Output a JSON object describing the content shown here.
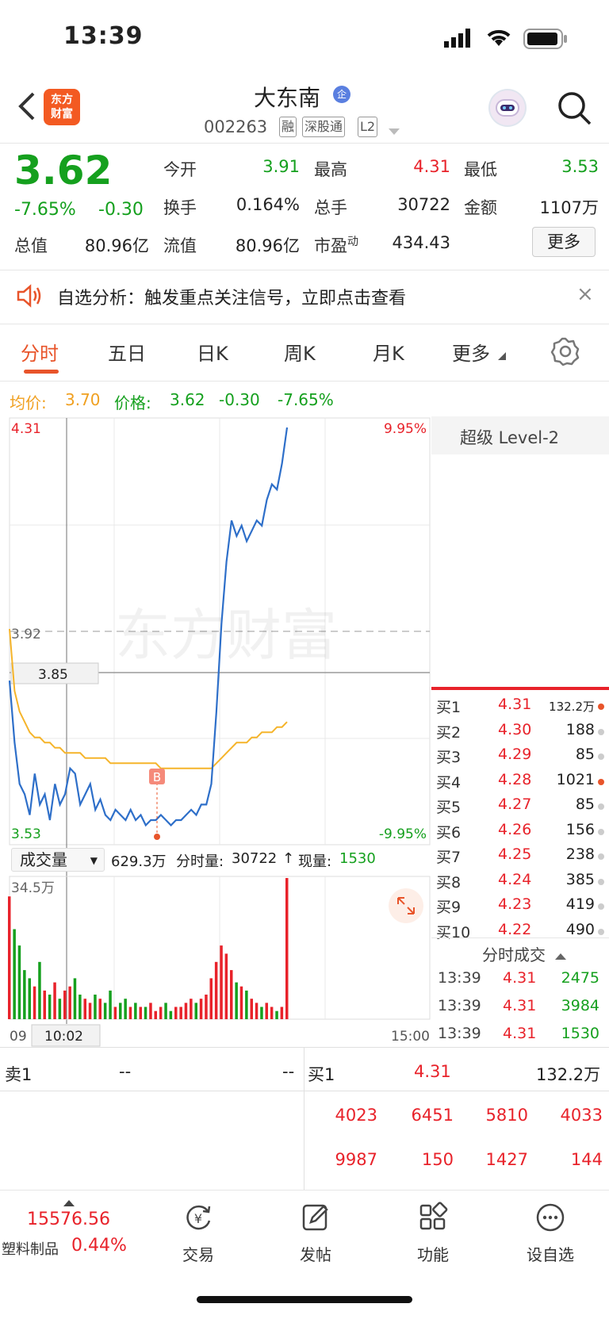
{
  "status_bar": {
    "time": "13:39"
  },
  "header": {
    "logo_text_1": "东方",
    "logo_text_2": "财富",
    "stock_name": "大东南",
    "stock_badge": "企",
    "stock_code": "002263",
    "tags": [
      "融",
      "深股通",
      "L2"
    ]
  },
  "quote": {
    "price": "3.62",
    "change_pct": "-7.65%",
    "change_amt": "-0.30",
    "fields": [
      {
        "label": "今开",
        "value": "3.91",
        "color": "green"
      },
      {
        "label": "最高",
        "value": "4.31",
        "color": "red"
      },
      {
        "label": "最低",
        "value": "3.53",
        "color": "green"
      },
      {
        "label": "换手",
        "value": "0.164%",
        "color": "black"
      },
      {
        "label": "总手",
        "value": "30722",
        "color": "black"
      },
      {
        "label": "金额",
        "value": "1107万",
        "color": "black"
      },
      {
        "label": "总值",
        "value": "80.96亿",
        "color": "black"
      },
      {
        "label": "流值",
        "value": "80.96亿",
        "color": "black"
      },
      {
        "label": "市盈动",
        "value": "434.43",
        "color": "black"
      }
    ],
    "pe_label_main": "市盈",
    "pe_label_sup": "动",
    "more_label": "更多"
  },
  "banner": {
    "text": "自选分析：触发重点关注信号，立即点击查看",
    "close": "×"
  },
  "tabs": [
    "分时",
    "五日",
    "日K",
    "周K",
    "月K",
    "更多"
  ],
  "legend": {
    "avg_label": "均价:",
    "avg_value": "3.70",
    "price_label": "价格:",
    "price_value": "3.62",
    "change_amt": "-0.30",
    "change_pct": "-7.65%"
  },
  "chart": {
    "price_high": "4.31",
    "price_low": "3.53",
    "pct_high": "9.95%",
    "pct_low": "-9.95%",
    "prev_close": "3.92",
    "cursor_price": "3.85",
    "watermark": "东方财富",
    "marker": "B",
    "vol_axis": "34.5万",
    "time_start": "09",
    "time_cursor": "10:02",
    "time_end": "15:00",
    "vol_selector": "成交量",
    "vol_total": "629.3万",
    "vol_fen_label": "分时量:",
    "vol_fen_value": "30722",
    "vol_arrow": "↑",
    "vol_now_label": "现量:",
    "vol_now_value": "1530"
  },
  "chart_data": {
    "type": "line",
    "title": "",
    "ylim": [
      3.53,
      4.31
    ],
    "prev_close": 3.92,
    "series": [
      {
        "name": "价格",
        "values": [
          3.82,
          3.7,
          3.62,
          3.6,
          3.56,
          3.64,
          3.58,
          3.6,
          3.55,
          3.62,
          3.58,
          3.6,
          3.65,
          3.64,
          3.58,
          3.6,
          3.62,
          3.57,
          3.59,
          3.56,
          3.55,
          3.57,
          3.56,
          3.55,
          3.57,
          3.55,
          3.56,
          3.54,
          3.55,
          3.55,
          3.56,
          3.55,
          3.54,
          3.55,
          3.55,
          3.56,
          3.57,
          3.56,
          3.58,
          3.58,
          3.62,
          3.76,
          3.93,
          4.05,
          4.13,
          4.1,
          4.12,
          4.09,
          4.11,
          4.13,
          4.12,
          4.17,
          4.2,
          4.19,
          4.24,
          4.31
        ]
      },
      {
        "name": "均价",
        "values": [
          3.92,
          3.8,
          3.76,
          3.74,
          3.72,
          3.71,
          3.71,
          3.7,
          3.7,
          3.69,
          3.69,
          3.68,
          3.68,
          3.68,
          3.68,
          3.67,
          3.67,
          3.67,
          3.67,
          3.67,
          3.66,
          3.66,
          3.66,
          3.66,
          3.66,
          3.66,
          3.66,
          3.66,
          3.66,
          3.66,
          3.65,
          3.65,
          3.65,
          3.65,
          3.65,
          3.65,
          3.65,
          3.65,
          3.65,
          3.65,
          3.65,
          3.66,
          3.67,
          3.68,
          3.69,
          3.7,
          3.7,
          3.7,
          3.71,
          3.71,
          3.72,
          3.72,
          3.72,
          3.73,
          3.73,
          3.74
        ]
      }
    ],
    "volume": [
      30,
      22,
      18,
      12,
      10,
      8,
      14,
      7,
      6,
      9,
      5,
      7,
      8,
      10,
      6,
      5,
      4,
      6,
      5,
      4,
      7,
      3,
      4,
      5,
      3,
      4,
      3,
      3,
      4,
      2,
      3,
      4,
      2,
      3,
      3,
      4,
      5,
      4,
      5,
      6,
      10,
      14,
      18,
      16,
      12,
      9,
      8,
      7,
      5,
      4,
      3,
      4,
      3,
      2,
      3,
      34.5
    ]
  },
  "level2": {
    "title": "超级 Level-2",
    "bids": [
      {
        "label": "买1",
        "price": "4.31",
        "vol": "132.2万",
        "active": true
      },
      {
        "label": "买2",
        "price": "4.30",
        "vol": "188",
        "active": false
      },
      {
        "label": "买3",
        "price": "4.29",
        "vol": "85",
        "active": false
      },
      {
        "label": "买4",
        "price": "4.28",
        "vol": "1021",
        "active": true
      },
      {
        "label": "买5",
        "price": "4.27",
        "vol": "85",
        "active": false
      },
      {
        "label": "买6",
        "price": "4.26",
        "vol": "156",
        "active": false
      },
      {
        "label": "买7",
        "price": "4.25",
        "vol": "238",
        "active": false
      },
      {
        "label": "买8",
        "price": "4.24",
        "vol": "385",
        "active": false
      },
      {
        "label": "买9",
        "price": "4.23",
        "vol": "419",
        "active": false
      },
      {
        "label": "买10",
        "price": "4.22",
        "vol": "490",
        "active": false
      }
    ],
    "ticks_title": "分时成交",
    "ticks": [
      {
        "time": "13:39",
        "price": "4.31",
        "vol": "2475"
      },
      {
        "time": "13:39",
        "price": "4.31",
        "vol": "3984"
      },
      {
        "time": "13:39",
        "price": "4.31",
        "vol": "1530"
      }
    ]
  },
  "orderbook": {
    "sell_label": "卖1",
    "sell_price": "--",
    "sell_vol": "--",
    "buy_label": "买1",
    "buy_price": "4.31",
    "buy_vol": "132.2万",
    "queue_row1": [
      "4023",
      "6451",
      "5810",
      "4033"
    ],
    "queue_row2": [
      "9987",
      "150",
      "1427",
      "144"
    ]
  },
  "bottom_nav": {
    "index_value": "15576.56",
    "index_name": "塑料制品",
    "index_change": "0.44%",
    "items": [
      "交易",
      "发帖",
      "功能",
      "设自选"
    ]
  }
}
